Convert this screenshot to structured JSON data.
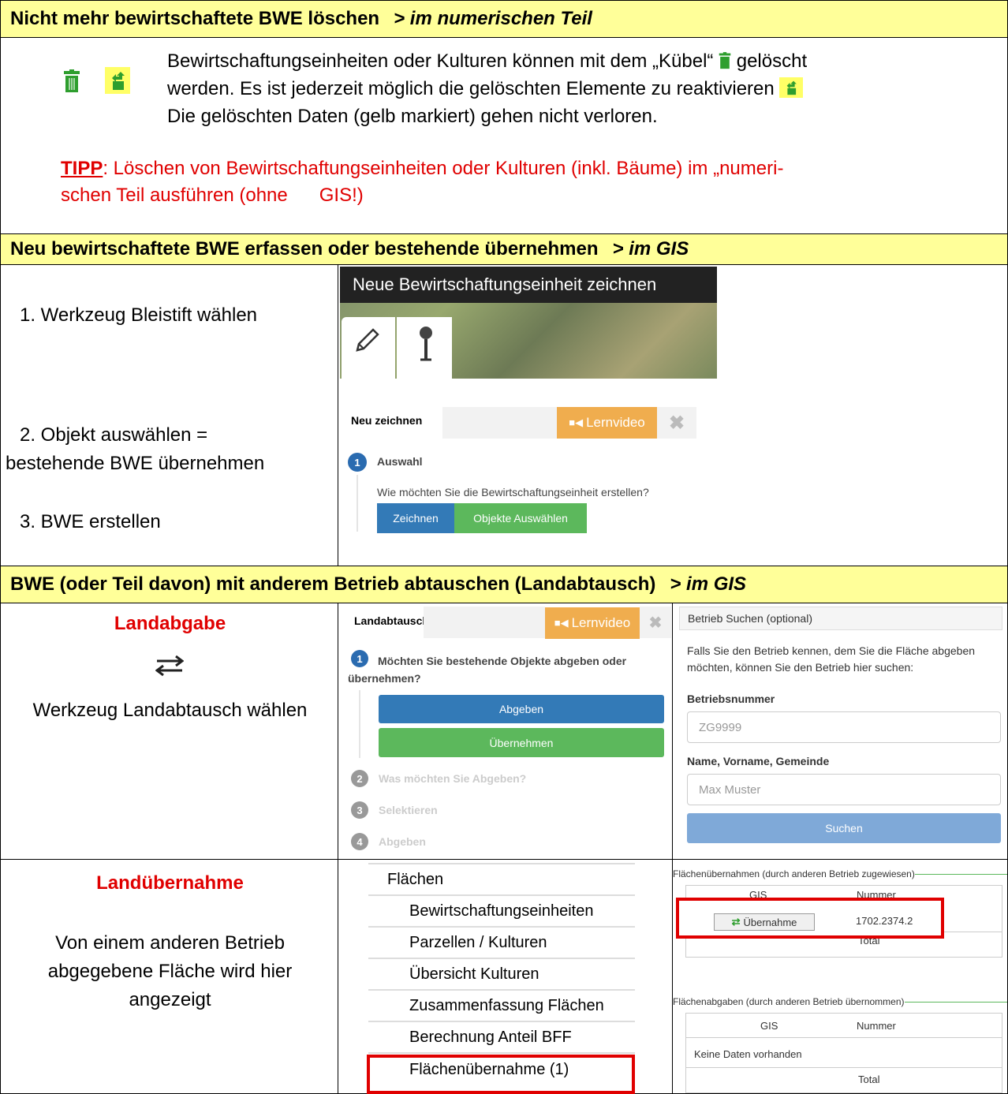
{
  "section1": {
    "title": "Nicht mehr bewirtschaftete BWE löschen",
    "context": "> im numerischen Teil",
    "line1": "Bewirtschaftungseinheiten oder Kulturen können mit dem „Kübel“",
    "line1_end": "gelöscht",
    "line2": "werden. Es ist jederzeit möglich die gelöschten Elemente zu reaktivieren",
    "line3": "Die gelöschten Daten (gelb markiert) gehen nicht verloren.",
    "tip_label": "TIPP",
    "tip_line1": ": Löschen von Bewirtschaftungseinheiten oder Kulturen (inkl. Bäume) im „numeri-",
    "tip_line2": "schen Teil ausführen (ohne      GIS!)"
  },
  "section2": {
    "title": "Neu bewirtschaftete BWE erfassen oder bestehende übernehmen",
    "context": "> im GIS",
    "step1": "1. Werkzeug Bleistift wählen",
    "step2a": "2. Objekt auswählen =",
    "step2b": "bestehende BWE übernehmen",
    "step3": "3. BWE erstellen",
    "tooltip": "Neue Bewirtschaftungseinheit zeichnen",
    "panel_tab": "Neu zeichnen",
    "lernvideo": "Lernvideo",
    "step_number": "1",
    "step_title": "Auswahl",
    "question": "Wie möchten Sie die Bewirtschaftungseinheit erstellen?",
    "btn_draw": "Zeichnen",
    "btn_select": "Objekte Auswählen"
  },
  "section3": {
    "title": "BWE (oder Teil davon) mit anderem Betrieb abtauschen (Landabtausch)",
    "context": "> im GIS",
    "landabgabe": "Landabgabe",
    "tool_text": "Werkzeug Landabtausch wählen",
    "panel_tab": "Landabtausch",
    "lernvideo": "Lernvideo",
    "steps": [
      {
        "num": "1",
        "text": "Möchten Sie bestehende Objekte abgeben oder übernehmen?"
      },
      {
        "num": "2",
        "text": "Was möchten Sie Abgeben?"
      },
      {
        "num": "3",
        "text": "Selektieren"
      },
      {
        "num": "4",
        "text": "Abgeben"
      }
    ],
    "btn_abgeben": "Abgeben",
    "btn_uebernehmen": "Übernehmen",
    "search_header": "Betrieb Suchen (optional)",
    "search_desc1": "Falls Sie den Betrieb kennen, dem Sie die Fläche abgeben",
    "search_desc2": "möchten, können Sie den Betrieb hier suchen:",
    "label_number": "Betriebsnummer",
    "placeholder_number": "ZG9999",
    "label_name": "Name, Vorname, Gemeinde",
    "placeholder_name": "Max Muster",
    "btn_search": "Suchen"
  },
  "section4": {
    "landuebernahme": "Landübernahme",
    "desc1": "Von einem anderen Betrieb",
    "desc2": "abgegebene Fläche wird hier",
    "desc3": "angezeigt",
    "menu": [
      "Flächen",
      "Bewirtschaftungseinheiten",
      "Parzellen / Kulturen",
      "Übersicht Kulturen",
      "Zusammenfassung Flächen",
      "Berechnung Anteil BFF",
      "Flächenübernahme (1)"
    ],
    "table1_title": "Flächenübernahmen (durch anderen Betrieb zugewiesen)",
    "table2_title": "Flächenabgaben (durch anderen Betrieb übernommen)",
    "col_gis": "GIS",
    "col_nummer": "Nummer",
    "btn_uebernahme": "Übernahme",
    "row_number": "1702.2374.2",
    "total": "Total",
    "no_data": "Keine Daten vorhanden"
  },
  "colors": {
    "header_bg": "#ffff99",
    "red": "#e00000",
    "blue": "#337ab7",
    "green": "#5cb85c",
    "orange": "#f0ad4e"
  }
}
